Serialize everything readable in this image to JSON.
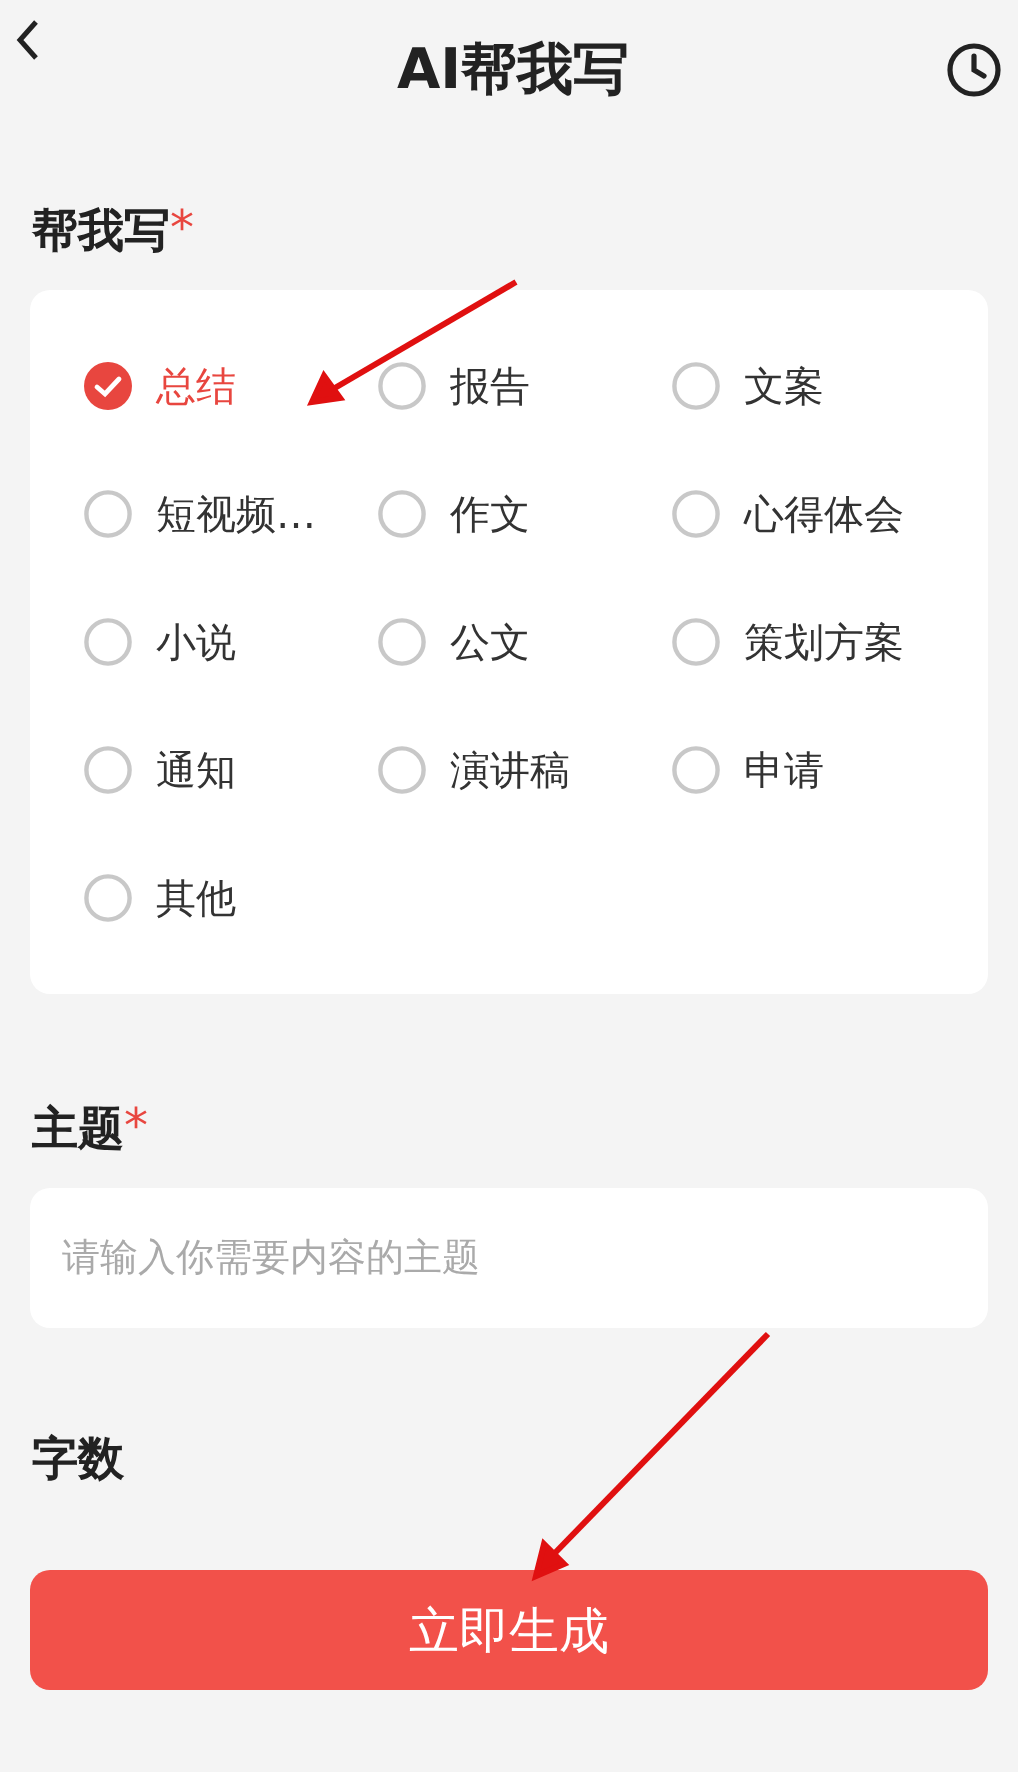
{
  "header": {
    "title": "AI帮我写"
  },
  "type_section": {
    "label": "帮我写",
    "required_mark": "*",
    "options": [
      {
        "label": "总结",
        "selected": true
      },
      {
        "label": "报告",
        "selected": false
      },
      {
        "label": "文案",
        "selected": false
      },
      {
        "label": "短视频…",
        "selected": false
      },
      {
        "label": "作文",
        "selected": false
      },
      {
        "label": "心得体会",
        "selected": false
      },
      {
        "label": "小说",
        "selected": false
      },
      {
        "label": "公文",
        "selected": false
      },
      {
        "label": "策划方案",
        "selected": false
      },
      {
        "label": "通知",
        "selected": false
      },
      {
        "label": "演讲稿",
        "selected": false
      },
      {
        "label": "申请",
        "selected": false
      },
      {
        "label": "其他",
        "selected": false
      }
    ]
  },
  "topic_section": {
    "label": "主题",
    "required_mark": "*",
    "placeholder": "请输入你需要内容的主题"
  },
  "count_section": {
    "label": "字数"
  },
  "generate_button": {
    "label": "立即生成"
  }
}
